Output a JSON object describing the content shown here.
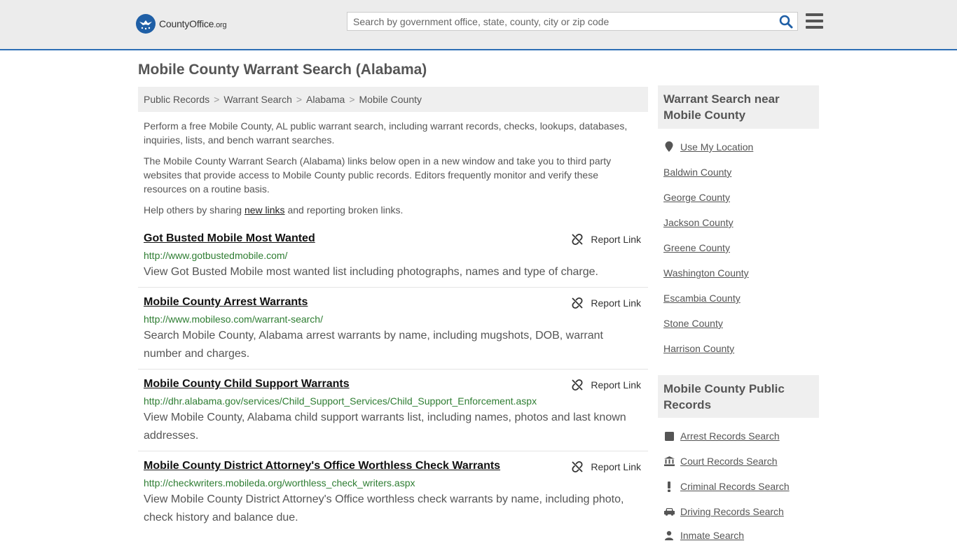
{
  "header": {
    "logo_text": "CountyOffice",
    "logo_suffix": ".org",
    "search_placeholder": "Search by government office, state, county, city or zip code"
  },
  "page_title": "Mobile County Warrant Search (Alabama)",
  "breadcrumb": [
    "Public Records",
    "Warrant Search",
    "Alabama",
    "Mobile County"
  ],
  "intro": {
    "p1": "Perform a free Mobile County, AL public warrant search, including warrant records, checks, lookups, databases, inquiries, lists, and bench warrant searches.",
    "p2": "The Mobile County Warrant Search (Alabama) links below open in a new window and take you to third party websites that provide access to Mobile County public records. Editors frequently monitor and verify these resources on a routine basis.",
    "p3_before": "Help others by sharing",
    "p3_link": "new links",
    "p3_after": "and reporting broken links."
  },
  "report_label": "Report Link",
  "results": [
    {
      "title": "Got Busted Mobile Most Wanted",
      "url": "http://www.gotbustedmobile.com/",
      "desc": "View Got Busted Mobile most wanted list including photographs, names and type of charge."
    },
    {
      "title": "Mobile County Arrest Warrants",
      "url": "http://www.mobileso.com/warrant-search/",
      "desc": "Search Mobile County, Alabama arrest warrants by name, including mugshots, DOB, warrant number and charges."
    },
    {
      "title": "Mobile County Child Support Warrants",
      "url": "http://dhr.alabama.gov/services/Child_Support_Services/Child_Support_Enforcement.aspx",
      "desc": "View Mobile County, Alabama child support warrants list, including names, photos and last known addresses."
    },
    {
      "title": "Mobile County District Attorney's Office Worthless Check Warrants",
      "url": "http://checkwriters.mobileda.org/worthless_check_writers.aspx",
      "desc": "View Mobile County District Attorney's Office worthless check warrants by name, including photo, check history and balance due."
    }
  ],
  "sidebar": {
    "nearby_title": "Warrant Search near Mobile County",
    "use_location": "Use My Location",
    "nearby": [
      "Baldwin County",
      "George County",
      "Jackson County",
      "Greene County",
      "Washington County",
      "Escambia County",
      "Stone County",
      "Harrison County"
    ],
    "records_title": "Mobile County Public Records",
    "records": [
      {
        "label": "Arrest Records Search",
        "icon": "square-icon"
      },
      {
        "label": "Court Records Search",
        "icon": "courthouse-icon"
      },
      {
        "label": "Criminal Records Search",
        "icon": "exclamation-icon"
      },
      {
        "label": "Driving Records Search",
        "icon": "car-icon"
      },
      {
        "label": "Inmate Search",
        "icon": "inmate-icon"
      }
    ]
  },
  "colors": {
    "accent_blue": "#2d6eb5",
    "url_green": "#2e7d32",
    "header_bg": "#ececec",
    "panel_bg": "#efefef"
  }
}
